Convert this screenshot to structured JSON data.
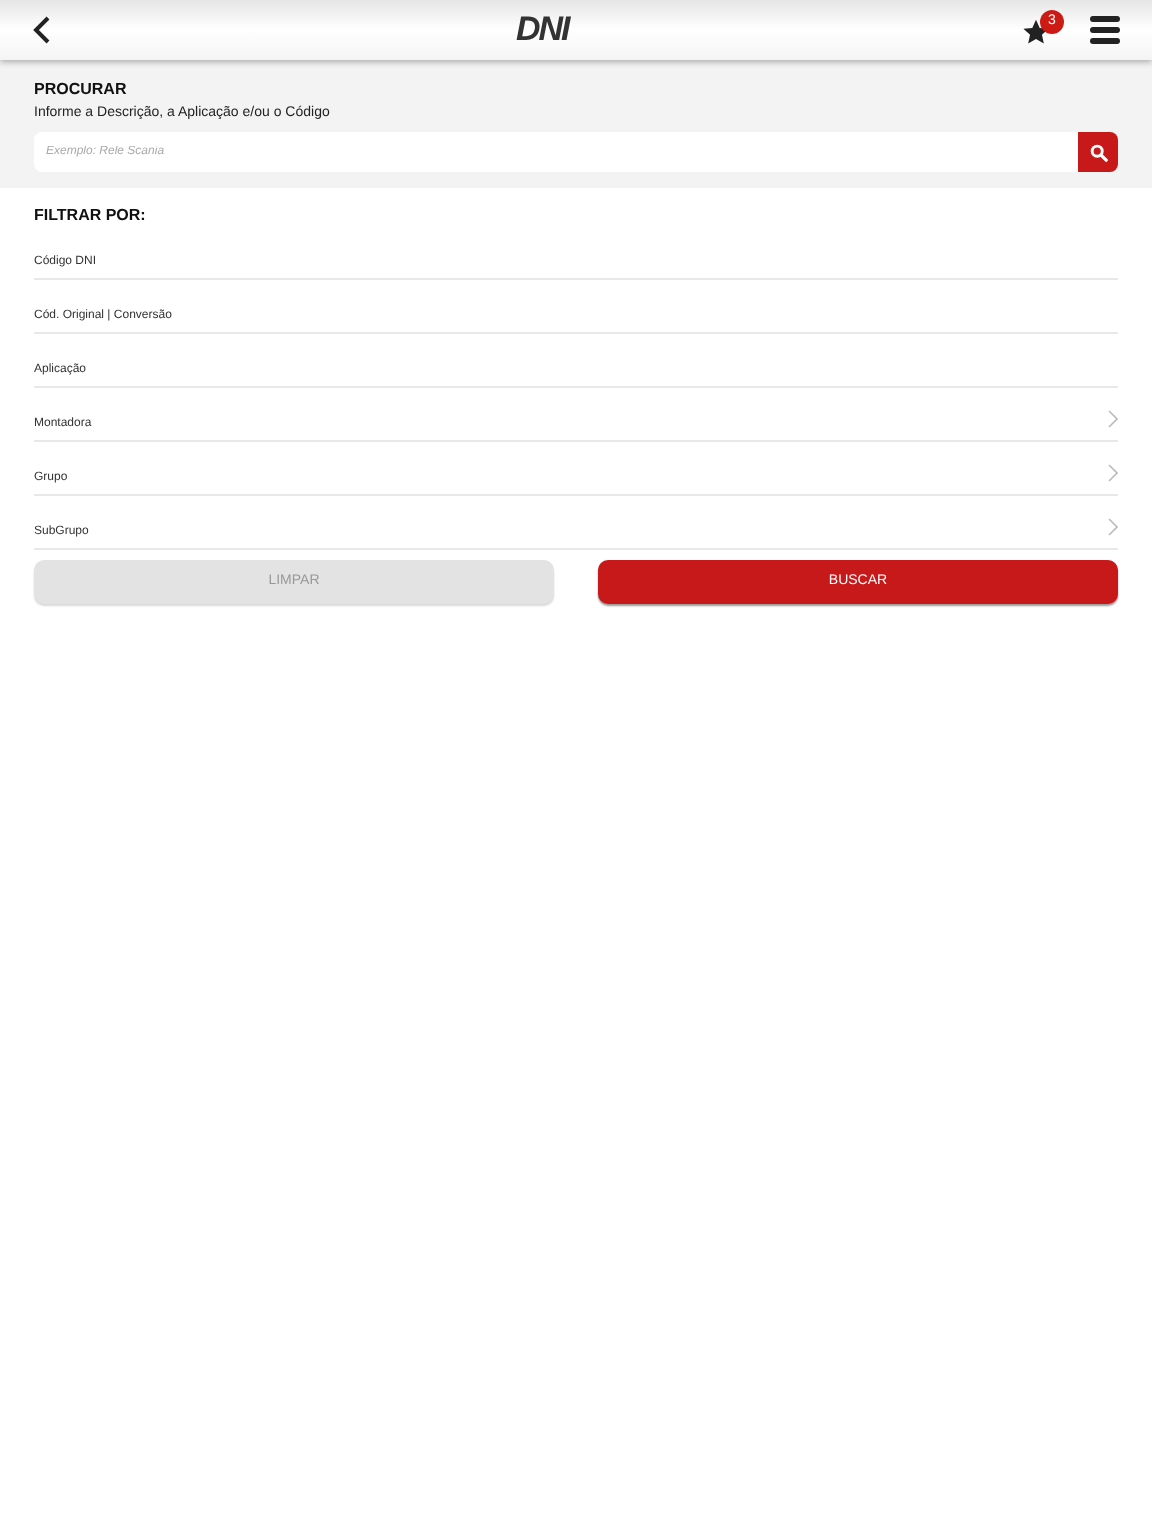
{
  "header": {
    "logo": "DNI",
    "favorites_count": "3"
  },
  "search": {
    "title": "PROCURAR",
    "hint": "Informe a Descrição, a Aplicação e/ou o Código",
    "placeholder": "Exemplo: Rele Scania"
  },
  "filters": {
    "title": "FILTRAR POR:",
    "items": [
      {
        "label": "Código DNI",
        "kind": "text"
      },
      {
        "label": "Cód. Original | Conversão",
        "kind": "text"
      },
      {
        "label": "Aplicação",
        "kind": "text"
      },
      {
        "label": "Montadora",
        "kind": "select"
      },
      {
        "label": "Grupo",
        "kind": "select"
      },
      {
        "label": "SubGrupo",
        "kind": "select"
      }
    ]
  },
  "buttons": [
    {
      "label": "LIMPAR",
      "kind": "secondary"
    },
    {
      "label": "BUSCAR",
      "kind": "primary"
    }
  ]
}
